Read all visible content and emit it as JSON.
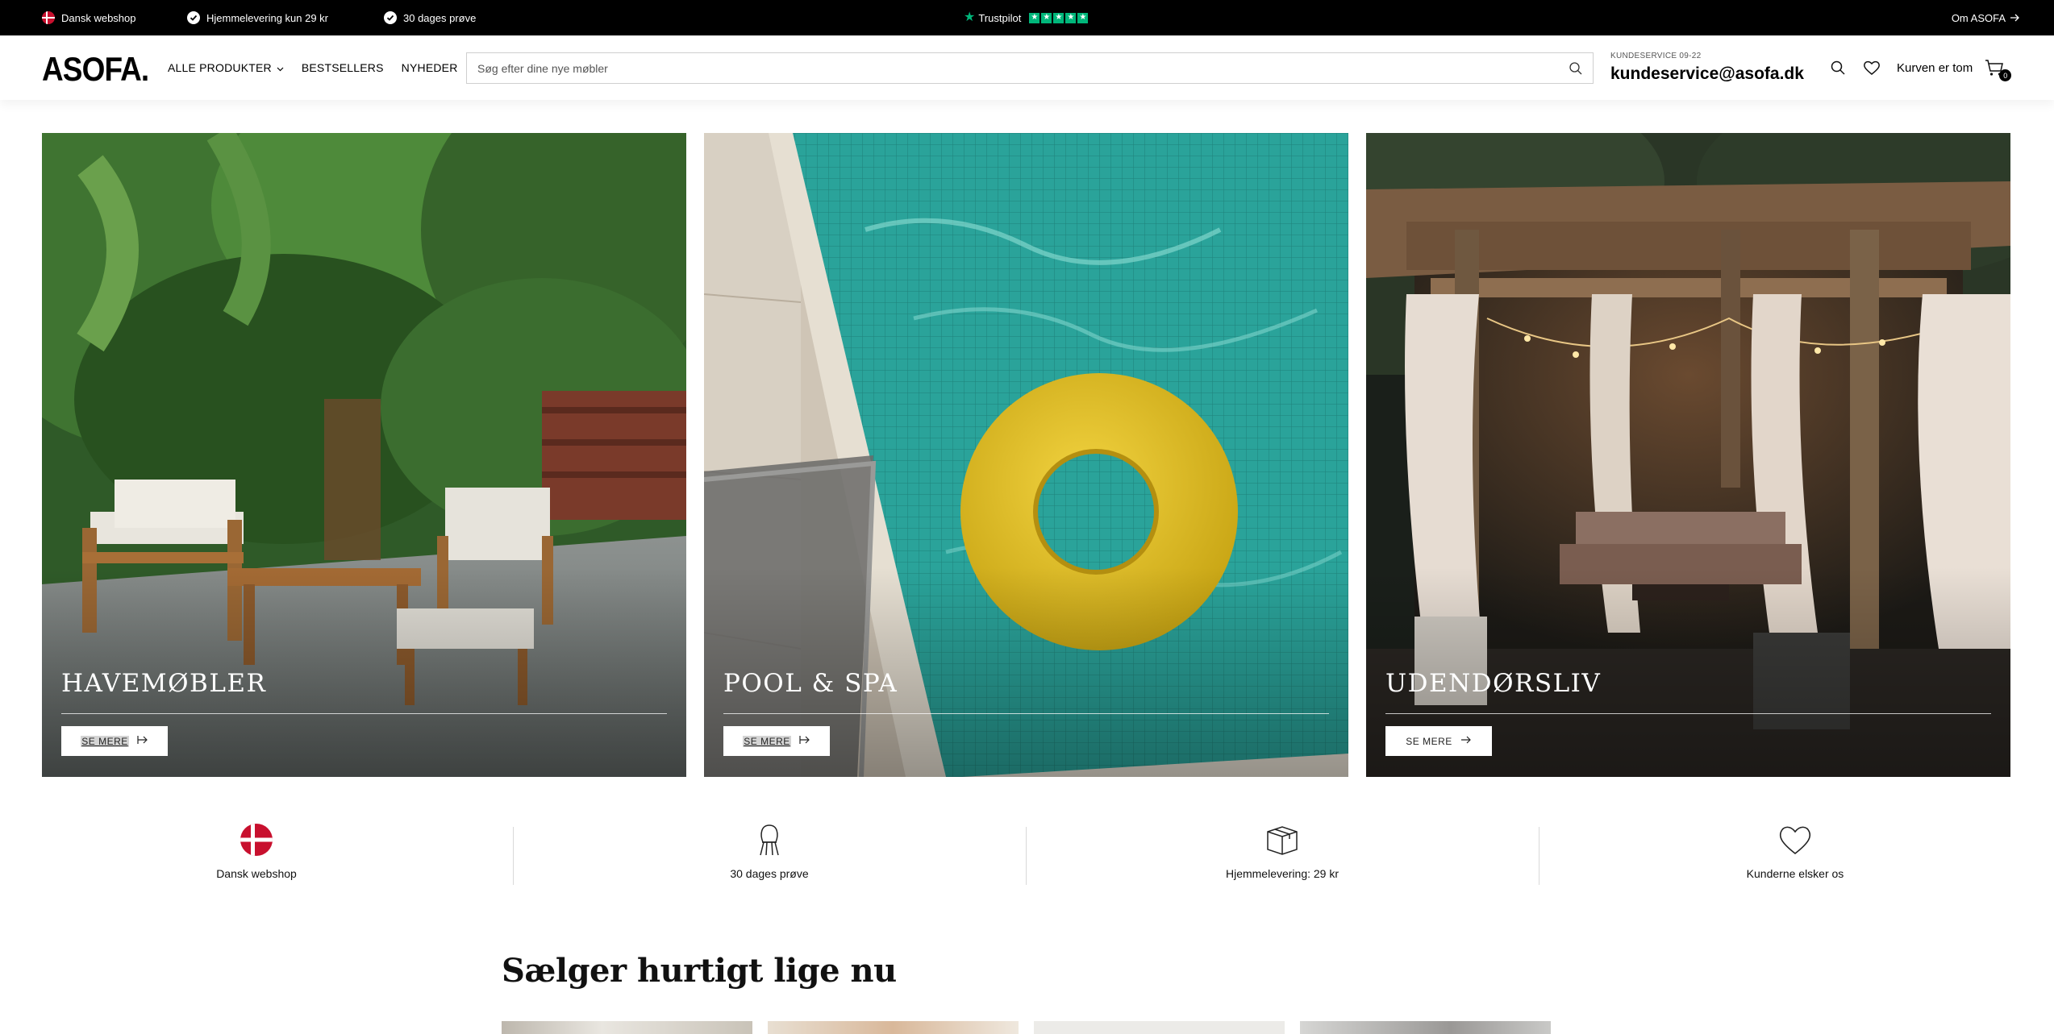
{
  "topbar": {
    "usps": [
      {
        "icon": "danish-flag-icon",
        "text": "Dansk webshop"
      },
      {
        "icon": "checkmark-icon",
        "text": "Hjemmelevering kun 29 kr"
      },
      {
        "icon": "checkmark-icon",
        "text": "30 dages prøve"
      }
    ],
    "trustpilot": {
      "label": "Trustpilot",
      "rating_stars": 5
    },
    "about_link": "Om ASOFA"
  },
  "header": {
    "logo": "ASOFA.",
    "nav": [
      {
        "label": "ALLE PRODUKTER",
        "has_dropdown": true
      },
      {
        "label": "BESTSELLERS"
      },
      {
        "label": "NYHEDER"
      }
    ],
    "search": {
      "placeholder": "Søg efter dine nye møbler",
      "value": ""
    },
    "service": {
      "label": "KUNDESERVICE 09-22",
      "email": "kundeservice@asofa.dk"
    },
    "cart": {
      "label": "Kurven er tom",
      "count": "0"
    }
  },
  "tiles": [
    {
      "title": "HAVEMØBLER",
      "button": "SE MERE",
      "image": "garden furniture on patio with tropical plants"
    },
    {
      "title": "POOL & SPA",
      "button": "SE MERE",
      "image": "yellow inflatable ring floating in a tiled pool"
    },
    {
      "title": "UDENDØRSLIV",
      "button": "SE MERE",
      "image": "wooden pergola with curtains and string lights at night"
    }
  ],
  "usp_row": [
    {
      "icon": "danish-flag-icon",
      "label": "Dansk webshop"
    },
    {
      "icon": "chair-icon",
      "label": "30 dages prøve"
    },
    {
      "icon": "box-icon",
      "label": "Hjemmelevering: 29 kr"
    },
    {
      "icon": "heart-icon",
      "label": "Kunderne elsker os"
    }
  ],
  "section": {
    "title": "Sælger hurtigt lige nu"
  },
  "colors": {
    "topbar_bg": "#000000",
    "trustpilot_green": "#00b67a",
    "flag_red": "#c8102e"
  }
}
